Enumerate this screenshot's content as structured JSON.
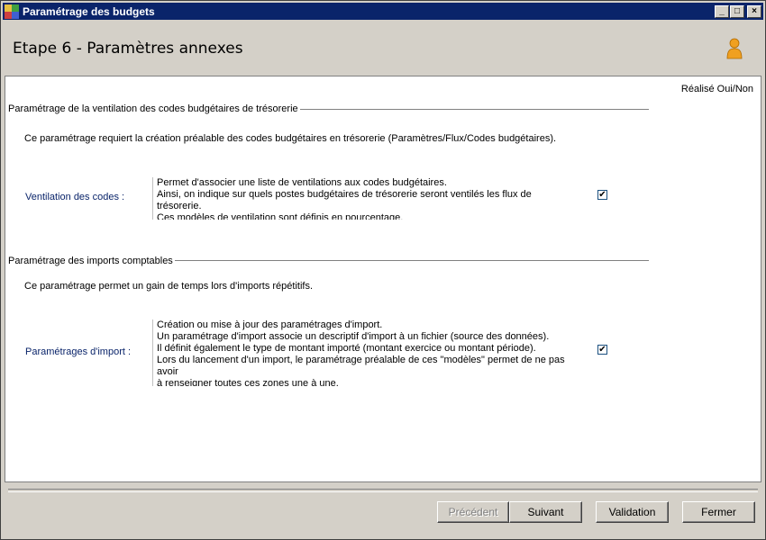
{
  "window": {
    "title": "Paramétrage des budgets",
    "min_glyph": "_",
    "max_glyph": "□",
    "close_glyph": "×"
  },
  "header": {
    "step_title": "Etape 6 - Paramètres annexes"
  },
  "content": {
    "done_label": "Réalisé Oui/Non",
    "sections": [
      {
        "title": "Paramétrage de la ventilation des codes budgétaires de trésorerie",
        "description": "Ce paramétrage requiert la création préalable des codes budgétaires en trésorerie (Paramètres/Flux/Codes budgétaires).",
        "row": {
          "label": "Ventilation des codes :",
          "lines": [
            "Permet d'associer une liste de ventilations aux codes budgétaires.",
            "Ainsi, on indique sur quels postes budgétaires de trésorerie seront ventilés les flux de",
            "trésorerie.",
            "Ces modèles de ventilation sont définis en pourcentage."
          ],
          "checked": true
        }
      },
      {
        "title": "Paramétrage des imports comptables",
        "description": "Ce paramétrage permet un gain de temps lors d'imports répétitifs.",
        "row": {
          "label": "Paramétrages d'import :",
          "lines": [
            "Création ou mise à jour des paramétrages d'import.",
            "Un paramétrage d'import associe un descriptif d'import à un fichier (source des données).",
            "Il définit également le type de montant importé (montant exercice ou montant période).",
            "Lors du lancement d'un import, le paramétrage préalable de ces \"modèles\" permet de ne pas",
            "avoir",
            "à renseigner toutes ces zones une à une."
          ],
          "checked": true
        }
      }
    ]
  },
  "footer": {
    "previous": "Précédent",
    "next": "Suivant",
    "validate": "Validation",
    "close": "Fermer"
  },
  "icons": {
    "app": "budget-app-icon",
    "user": "user-icon"
  },
  "colors": {
    "titlebar": "#0a246a",
    "link_label": "#0a246a",
    "user_icon": "#f0a020"
  }
}
